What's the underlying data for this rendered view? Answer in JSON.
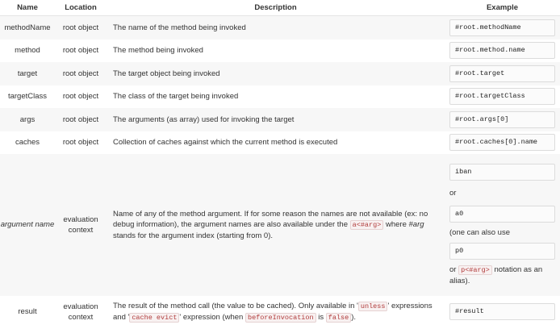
{
  "headers": {
    "name": "Name",
    "location": "Location",
    "description": "Description",
    "example": "Example"
  },
  "rows": {
    "methodName": {
      "name": "methodName",
      "location": "root object",
      "description": "The name of the method being invoked",
      "example": "#root.methodName"
    },
    "method": {
      "name": "method",
      "location": "root object",
      "description": "The method being invoked",
      "example": "#root.method.name"
    },
    "target": {
      "name": "target",
      "location": "root object",
      "description": "The target object being invoked",
      "example": "#root.target"
    },
    "targetClass": {
      "name": "targetClass",
      "location": "root object",
      "description": "The class of the target being invoked",
      "example": "#root.targetClass"
    },
    "args": {
      "name": "args",
      "location": "root object",
      "description": "The arguments (as array) used for invoking the target",
      "example": "#root.args[0]"
    },
    "caches": {
      "name": "caches",
      "location": "root object",
      "description": "Collection of caches against which the current method is executed",
      "example": "#root.caches[0].name"
    },
    "argument": {
      "name": "argument name",
      "location": "evaluation context",
      "description_1": "Name of any of the method argument. If for some reason the names are not available (ex: no debug information), the argument names are also available under the ",
      "description_code": "a<#arg>",
      "description_2": " where ",
      "description_em": "#arg",
      "description_3": " stands for the argument index (starting from 0).",
      "example_1": "iban",
      "or_1": "or",
      "example_2": "a0",
      "note_1": "(one can also use",
      "example_3": "p0",
      "note_2_a": "or ",
      "note_2_code": "p<#arg>",
      "note_2_b": " notation as an alias)."
    },
    "result": {
      "name": "result",
      "location": "evaluation context",
      "description_1": "The result of the method call (the value to be cached). Only available in '",
      "code_unless": "unless",
      "description_2": "' expressions and '",
      "code_cache_evict": "cache evict",
      "description_3": "' expression (when ",
      "code_before": "beforeInvocation",
      "description_4": " is ",
      "code_false": "false",
      "description_5": ").",
      "example": "#result"
    }
  }
}
